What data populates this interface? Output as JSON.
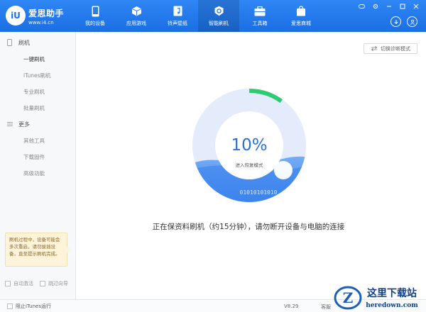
{
  "app": {
    "brand_name": "爱思助手",
    "brand_url": "www.i4.cn",
    "logo_text": "iU"
  },
  "nav": [
    {
      "label": "我的设备",
      "icon": "phone-icon"
    },
    {
      "label": "应用游戏",
      "icon": "cube-icon"
    },
    {
      "label": "铃声壁纸",
      "icon": "music-file-icon"
    },
    {
      "label": "智能刷机",
      "icon": "flash-gear-icon",
      "active": true
    },
    {
      "label": "工具箱",
      "icon": "toolbox-icon"
    },
    {
      "label": "爱思商城",
      "icon": "shopping-bag-icon"
    }
  ],
  "sidebar": {
    "group1": "刷机",
    "items1": [
      "一键刷机",
      "iTunes刷机",
      "专业刷机",
      "批量刷机"
    ],
    "group2": "更多",
    "items2": [
      "其他工具",
      "下载固件",
      "高级功能"
    ],
    "notice": "刷机过程中，设备可能会多次重启，请勿拔插设备，直至提示刷机完成。",
    "auto_activate": "自动激活",
    "skip_guide": "跳过向导"
  },
  "main": {
    "switch_mode": "切换诊断模式",
    "progress_percent": 10,
    "progress_label": "10%",
    "progress_sub": "进入恢复模式",
    "binary_text": "01010101010",
    "status": "正在保资料刷机（约15分钟），请勿断开设备与电脑的连接"
  },
  "bottom": {
    "block_itunes": "阻止iTunes运行",
    "version": "V8.29",
    "service": "客服"
  },
  "watermark": {
    "title": "这里下载站",
    "url": "heredown.com"
  },
  "colors": {
    "primary": "#1b72e6",
    "progress": "#2ecc71",
    "text": "#333333"
  }
}
